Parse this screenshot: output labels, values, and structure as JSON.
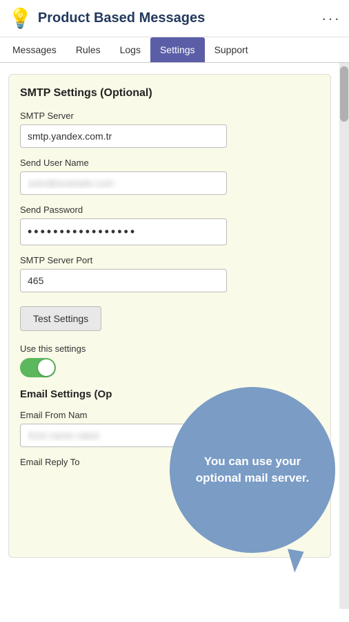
{
  "header": {
    "icon": "💡",
    "title": "Product Based Messages",
    "menu_label": "···"
  },
  "nav": {
    "tabs": [
      {
        "label": "Messages",
        "active": false
      },
      {
        "label": "Rules",
        "active": false
      },
      {
        "label": "Logs",
        "active": false
      },
      {
        "label": "Settings",
        "active": true
      },
      {
        "label": "Support",
        "active": false
      }
    ]
  },
  "smtp_section": {
    "title": "SMTP Settings (Optional)",
    "fields": [
      {
        "label": "SMTP Server",
        "value": "smtp.yandex.com.tr",
        "placeholder": "",
        "type": "text",
        "blurred": false,
        "name": "smtp-server-input"
      },
      {
        "label": "Send User Name",
        "value": "user@example.com",
        "placeholder": "",
        "type": "text",
        "blurred": true,
        "name": "send-username-input"
      },
      {
        "label": "Send Password",
        "value": "••••••••••••••••",
        "placeholder": "",
        "type": "password",
        "blurred": false,
        "name": "send-password-input"
      },
      {
        "label": "SMTP Server Port",
        "value": "465",
        "placeholder": "",
        "type": "text",
        "blurred": false,
        "name": "smtp-port-input"
      }
    ],
    "test_button_label": "Test Settings",
    "toggle_label": "Use this settings",
    "toggle_on": true
  },
  "email_section": {
    "title": "Email Settings (Op",
    "fields": [
      {
        "label": "Email From Nam",
        "value": "",
        "blurred": true,
        "name": "email-from-name-input"
      },
      {
        "label": "Email Reply To",
        "name": "email-reply-to-input"
      }
    ]
  },
  "tooltip": {
    "text": "You can use your optional mail server."
  }
}
